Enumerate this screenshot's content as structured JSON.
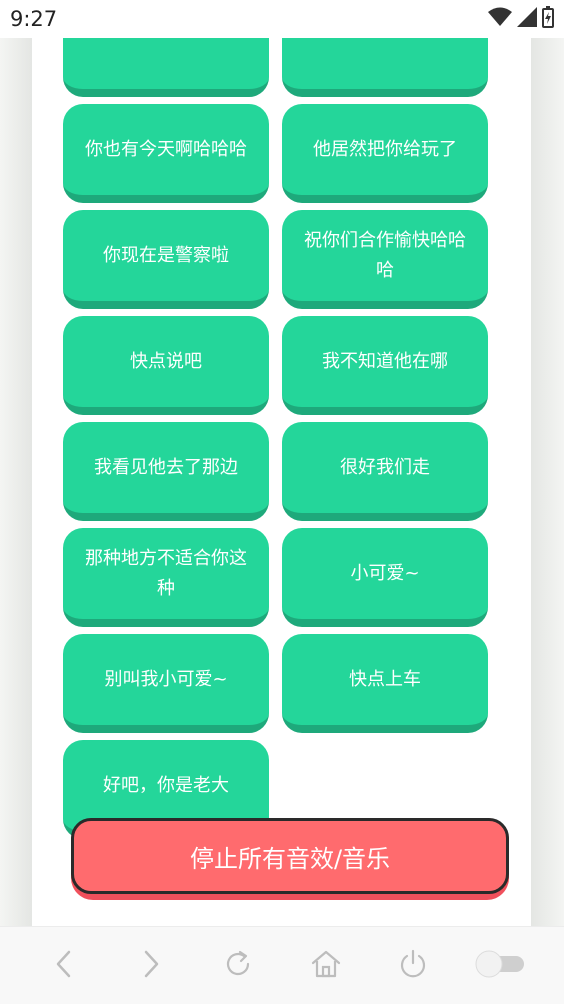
{
  "status_bar": {
    "time": "9:27"
  },
  "sound_buttons": [
    {
      "label": ""
    },
    {
      "label": ""
    },
    {
      "label": "你也有今天啊哈哈哈"
    },
    {
      "label": "他居然把你给玩了"
    },
    {
      "label": "你现在是警察啦"
    },
    {
      "label": "祝你们合作愉快哈哈哈"
    },
    {
      "label": "快点说吧"
    },
    {
      "label": "我不知道他在哪"
    },
    {
      "label": "我看见他去了那边"
    },
    {
      "label": "很好我们走"
    },
    {
      "label": "那种地方不适合你这种"
    },
    {
      "label": "小可爱~"
    },
    {
      "label": "别叫我小可爱~"
    },
    {
      "label": "快点上车"
    },
    {
      "label": "好吧，你是老大"
    }
  ],
  "stop_button": {
    "label": "停止所有音效/音乐"
  },
  "colors": {
    "button_green": "#24d69a",
    "button_green_shadow": "#1ea97b",
    "stop_red": "#ff6b6e"
  },
  "nav_bar": {
    "icons": [
      "back-icon",
      "forward-icon",
      "refresh-icon",
      "home-icon",
      "power-icon",
      "toggle-icon"
    ]
  }
}
